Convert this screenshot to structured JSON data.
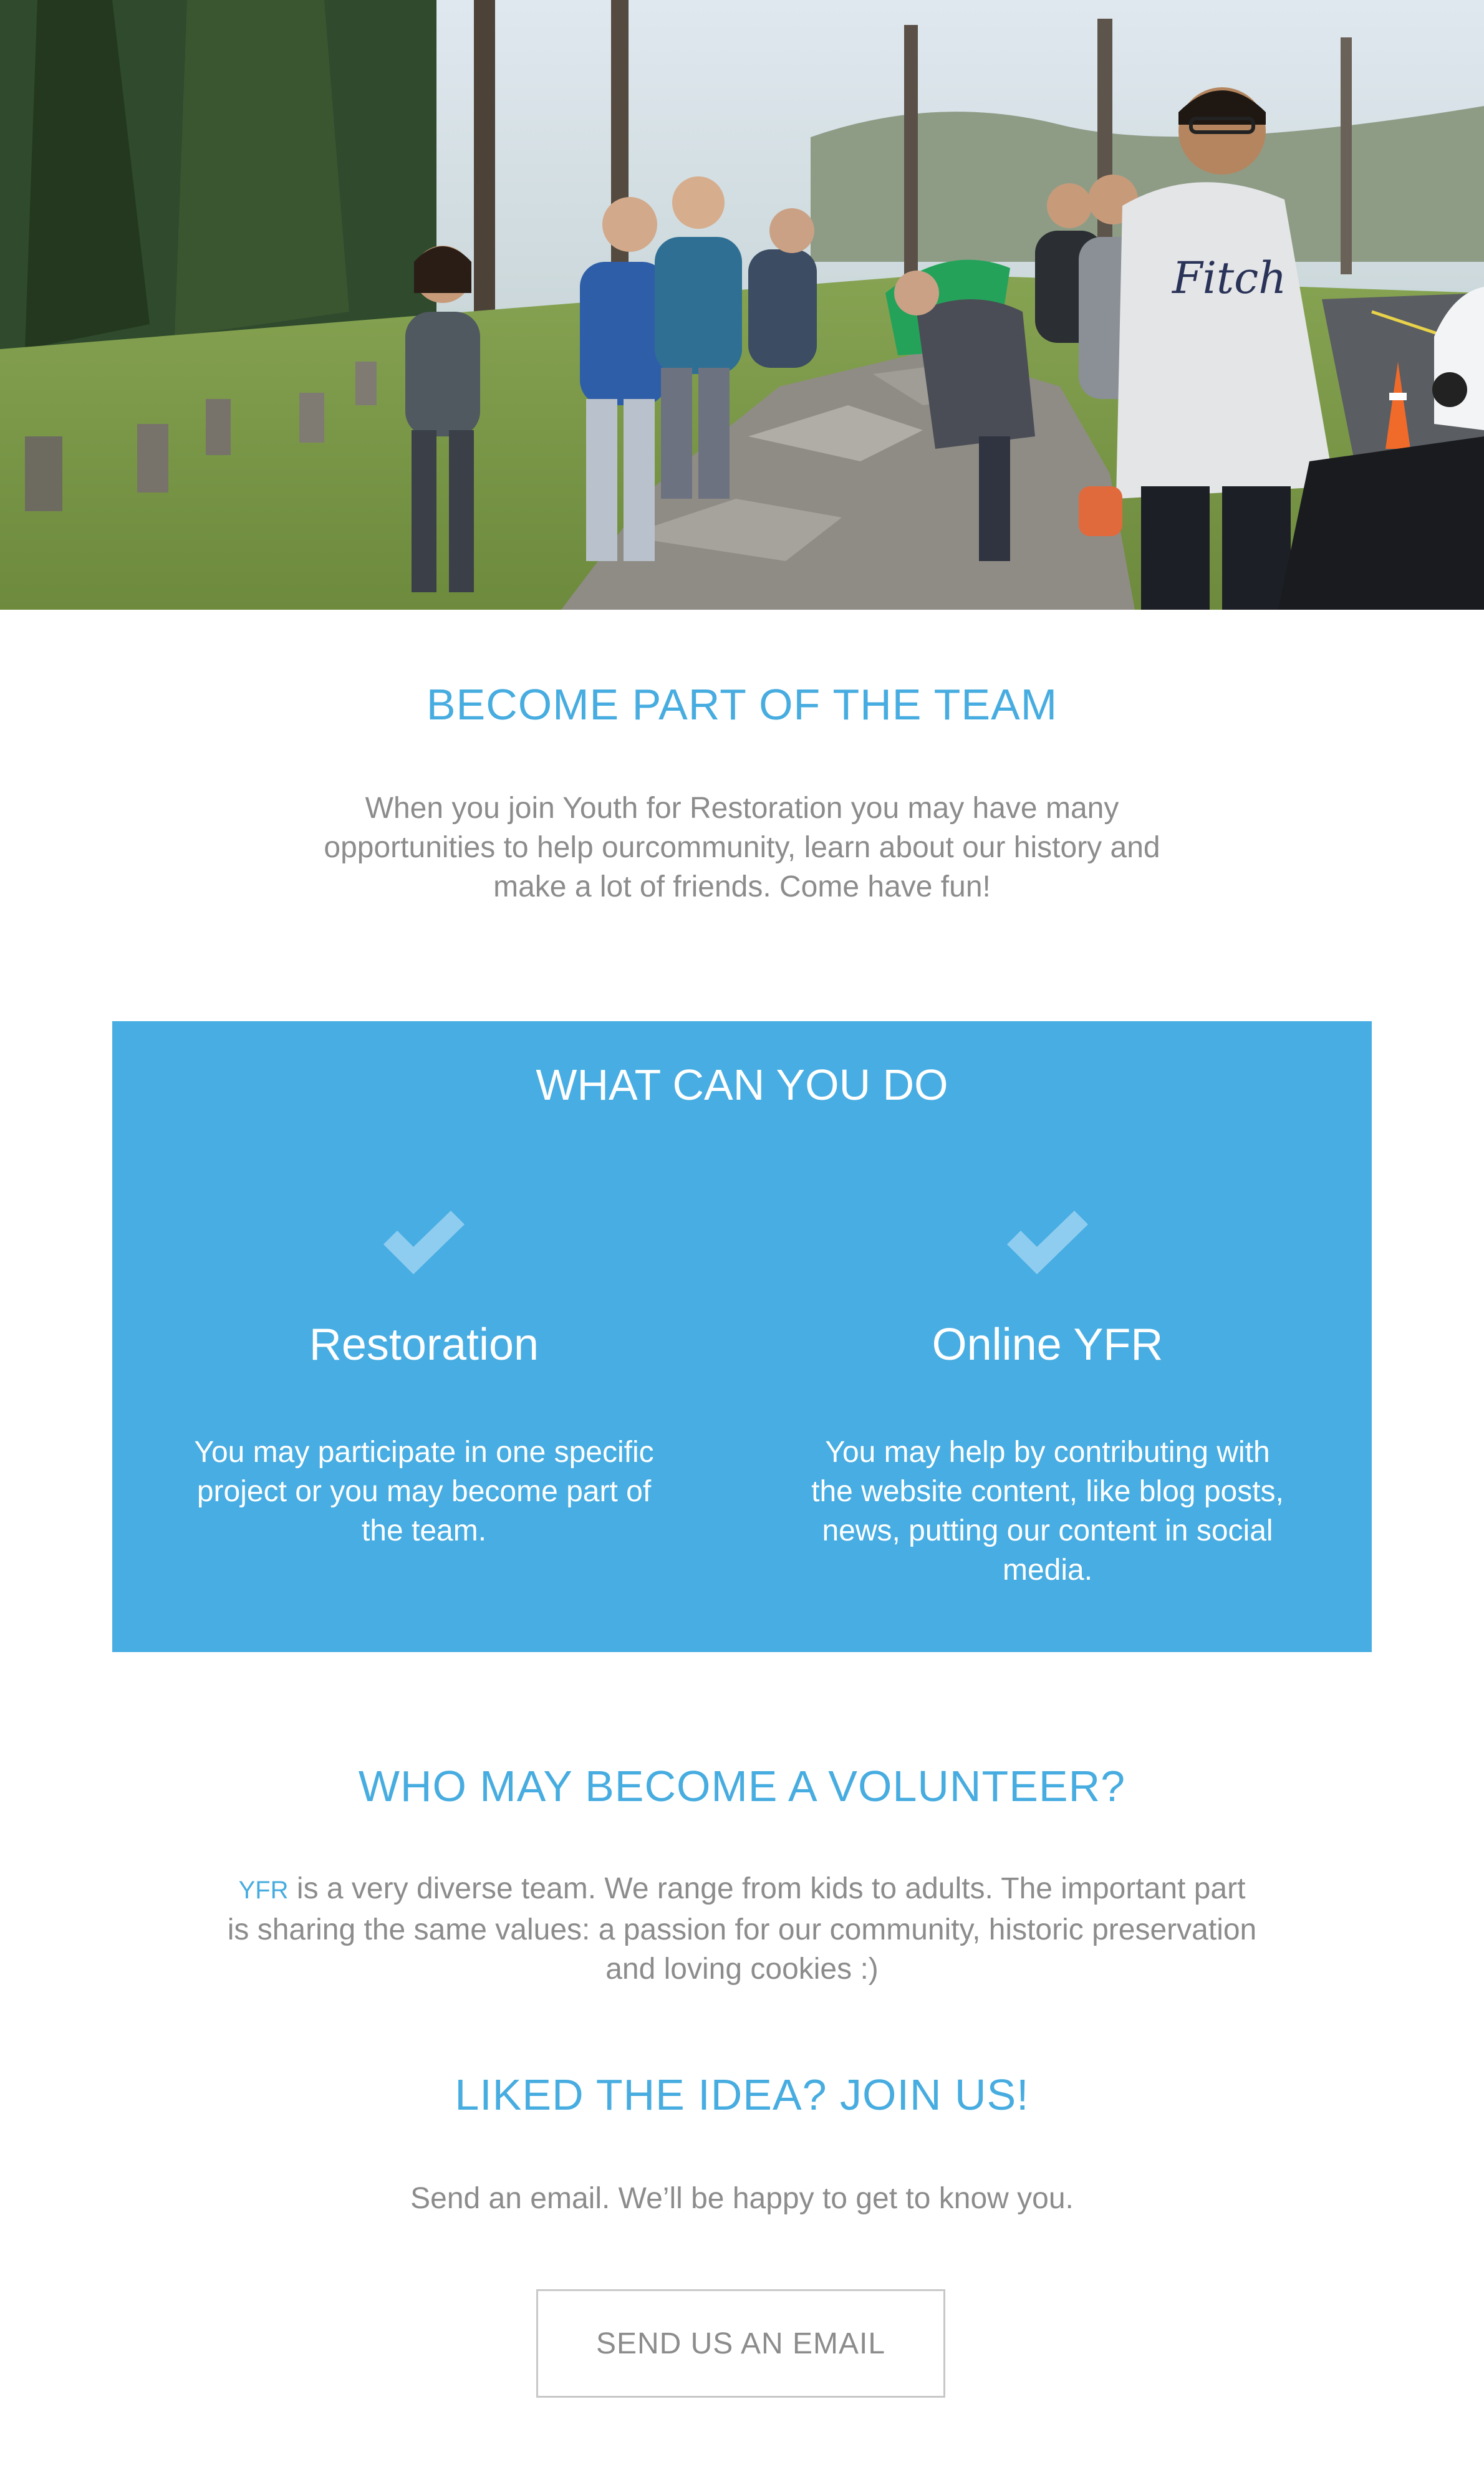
{
  "hero": {
    "icon": "volunteer-group-photo"
  },
  "team_section": {
    "title": "BECOME PART OF THE TEAM",
    "text": "When you join Youth for Restoration you may have many opportunities to help ourcommunity, learn about our history and make a lot of friends. Come have fun!"
  },
  "what_section": {
    "title": "WHAT CAN YOU DO",
    "background_color": "#47ade2",
    "items": [
      {
        "icon": "checkmark-icon",
        "title": "Restoration",
        "text": "You may participate in one specific project or you may become part of the team."
      },
      {
        "icon": "checkmark-icon",
        "title": "Online YFR",
        "text": "You may help by contributing with the website content, like blog posts, news, putting our content in social media."
      }
    ]
  },
  "volunteer_section": {
    "title": "WHO MAY BECOME A VOLUNTEER?",
    "highlight": "YFR",
    "text": " is a very diverse team.  We range from kids to adults.  The important part is sharing the same values: a passion for our community, historic preservation and loving cookies :)"
  },
  "join_section": {
    "title": "LIKED THE IDEA? JOIN US!",
    "text": "Send an email. We’ll be happy to get to know you.",
    "button_label": "SEND US AN EMAIL"
  },
  "colors": {
    "accent": "#47ace0",
    "body_text": "#8c8c8c",
    "button_border": "#c8c8c8"
  }
}
